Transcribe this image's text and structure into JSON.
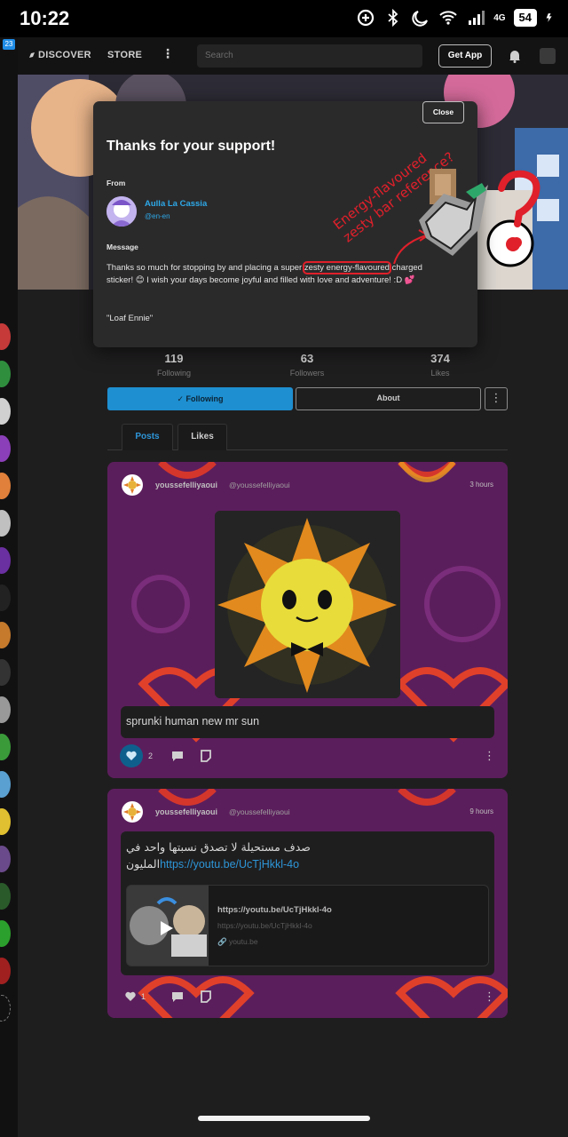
{
  "status_bar": {
    "time": "10:22",
    "network": "4G",
    "battery": "54"
  },
  "rail": {
    "badge": "23"
  },
  "nav": {
    "discover": "DISCOVER",
    "store": "STORE",
    "more": "⋮",
    "search_placeholder": "Search",
    "get_app": "Get App"
  },
  "stats": [
    {
      "value": "119",
      "label": "Following"
    },
    {
      "value": "63",
      "label": "Followers"
    },
    {
      "value": "374",
      "label": "Likes"
    }
  ],
  "actions": {
    "following": "Following",
    "about": "About",
    "more": "⋮"
  },
  "tabs": {
    "posts": "Posts",
    "likes": "Likes"
  },
  "posts": [
    {
      "user": "youssefelliyaoui",
      "handle": "@youssefelliyaoui",
      "time": "3 hours",
      "caption": "sprunki human new mr sun",
      "likes": "2"
    },
    {
      "user": "youssefelliyaoui",
      "handle": "@youssefelliyaoui",
      "time": "9 hours",
      "text_line1": "صدف مستحيلة لا تصدق نسبتها واحد في",
      "text_line2_prefix": "المليون",
      "text_link": "https://youtu.be/UcTjHkkl-4o",
      "link_title": "https://youtu.be/UcTjHkkl-4o",
      "link_url": "https://youtu.be/UcTjHkkl-4o",
      "link_domain": "youtu.be",
      "likes": "1"
    }
  ],
  "modal": {
    "close": "Close",
    "title": "Thanks for your support!",
    "from_label": "From",
    "sender_name": "Aulla La Cassia",
    "sender_handle": "@en-en",
    "message_label": "Message",
    "message_before": "Thanks so much for stopping by and placing a super ",
    "message_highlight": "zesty energy-flavoured",
    "message_after": " charged sticker! 😊 I wish your days become joyful and filled with love and adventure! :D 💕",
    "signature": "\"Loaf Ennie\""
  },
  "annotation": {
    "line1": "Energy-flavoured",
    "line2": "zesty bar reference?"
  },
  "colors": {
    "accent": "#1e8fd0",
    "link": "#2da9e8",
    "annotation": "#e0202a",
    "post_bg": "#5a1d5a"
  }
}
